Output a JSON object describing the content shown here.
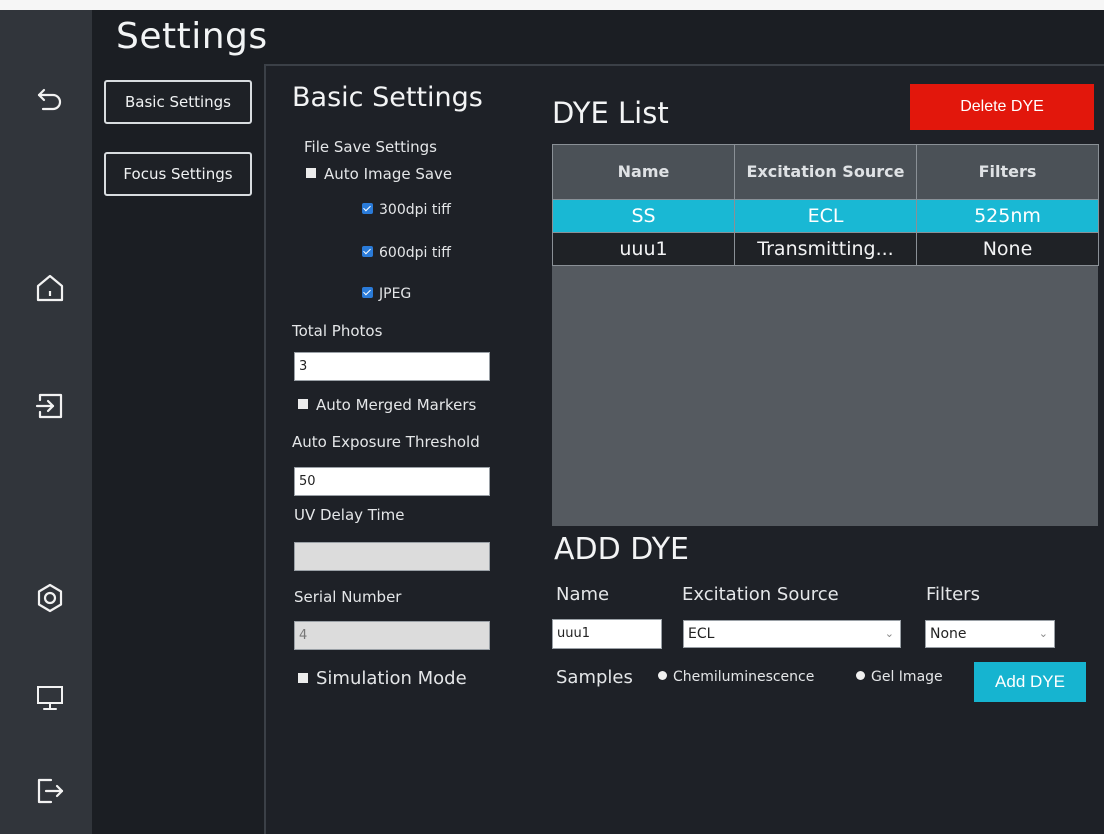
{
  "app": {
    "title": "Settings"
  },
  "sidebar": {
    "icons": [
      "back-icon",
      "home-icon",
      "import-icon",
      "settings-icon",
      "monitor-icon",
      "logout-icon"
    ]
  },
  "nav": {
    "basic_label": "Basic Settings",
    "focus_label": "Focus Settings"
  },
  "basic": {
    "title": "Basic Settings",
    "file_save_label": "File Save Settings",
    "auto_image_save": "Auto Image Save",
    "opt_300": "300dpi tiff",
    "opt_600": "600dpi tiff",
    "opt_jpeg": "JPEG",
    "total_photos_label": "Total Photos",
    "total_photos_value": "3",
    "auto_merged_markers": "Auto Merged Markers",
    "auto_exposure_label": "Auto Exposure Threshold",
    "auto_exposure_value": "50",
    "uv_delay_label": "UV Delay Time",
    "uv_delay_value": "",
    "serial_label": "Serial Number",
    "serial_value": "4",
    "simulation_mode": "Simulation Mode"
  },
  "dye_list": {
    "title": "DYE List",
    "delete_label": "Delete  DYE",
    "columns": [
      "Name",
      "Excitation Source",
      "Filters"
    ],
    "rows": [
      {
        "name": "SS",
        "source": "ECL",
        "filter": "525nm"
      },
      {
        "name": "uuu1",
        "source": "Transmitting...",
        "filter": "None"
      }
    ]
  },
  "add_dye": {
    "title": "ADD DYE",
    "name_label": "Name",
    "source_label": "Excitation Source",
    "filters_label": "Filters",
    "name_value": "uuu1",
    "source_value": "ECL",
    "filter_value": "None",
    "samples_label": "Samples",
    "opt_chemi": "Chemiluminescence",
    "opt_gel": "Gel Image",
    "add_label": "Add  DYE"
  },
  "colors": {
    "accent": "#19b8d4",
    "danger": "#e2170c",
    "sidebar_bg": "#31353b",
    "panel_bg": "#1e2127"
  }
}
